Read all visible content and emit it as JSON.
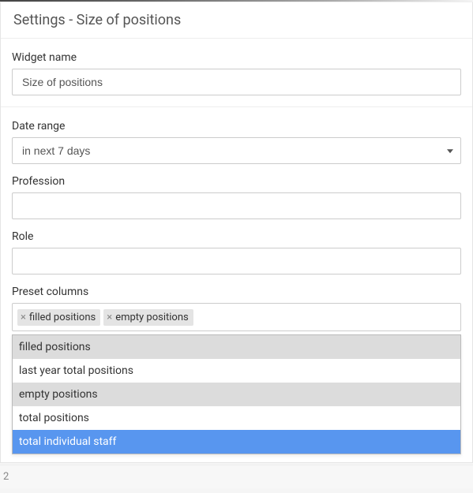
{
  "header": {
    "title": "Settings - Size of positions"
  },
  "fields": {
    "widget_name": {
      "label": "Widget name",
      "value": "Size of positions"
    },
    "date_range": {
      "label": "Date range",
      "value": "in next 7 days"
    },
    "profession": {
      "label": "Profession",
      "value": ""
    },
    "role": {
      "label": "Role",
      "value": ""
    },
    "preset_columns": {
      "label": "Preset columns",
      "tags": [
        {
          "label": "filled positions"
        },
        {
          "label": "empty positions"
        }
      ],
      "dropdown": [
        {
          "label": "filled positions",
          "state": "selected"
        },
        {
          "label": "last year total positions",
          "state": "normal"
        },
        {
          "label": "empty positions",
          "state": "selected"
        },
        {
          "label": "total positions",
          "state": "normal"
        },
        {
          "label": "total individual staff",
          "state": "highlight"
        }
      ]
    }
  },
  "footer_char": "2"
}
